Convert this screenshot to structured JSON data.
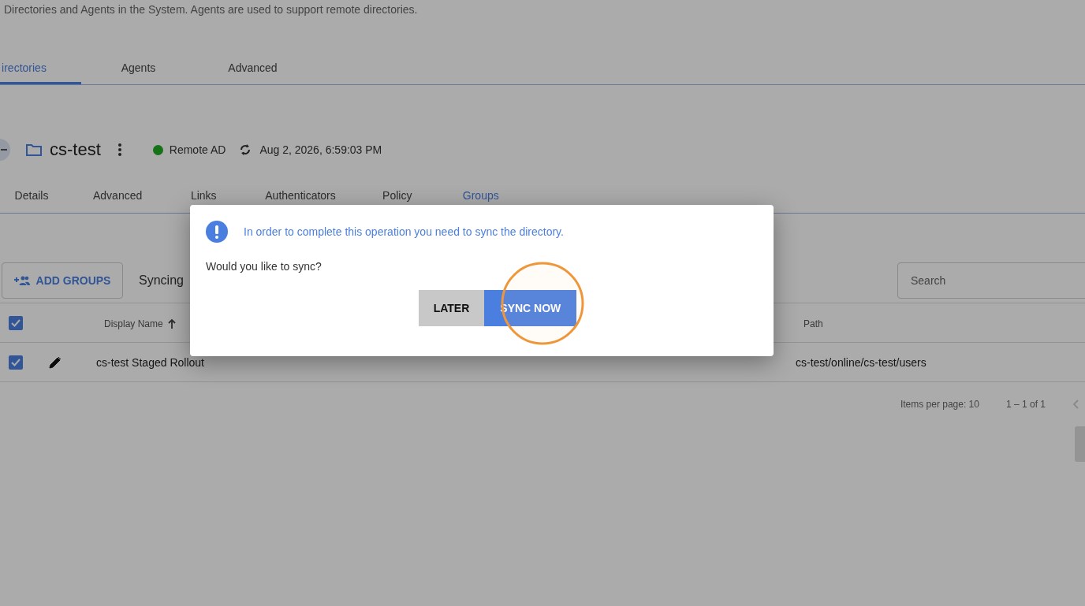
{
  "page": {
    "description": "Directories and Agents in the System. Agents are used to support remote directories."
  },
  "main_tabs": [
    {
      "label": "irectories",
      "selected": true
    },
    {
      "label": "Agents",
      "selected": false
    },
    {
      "label": "Advanced",
      "selected": false
    }
  ],
  "directory": {
    "name": "cs-test",
    "connected": true,
    "type": "Remote AD",
    "last_sync": "Aug 2, 2026, 6:59:03 PM"
  },
  "detail_tabs": [
    {
      "label": "Details",
      "selected": false
    },
    {
      "label": "Advanced",
      "selected": false
    },
    {
      "label": "Links",
      "selected": false
    },
    {
      "label": "Authenticators",
      "selected": false
    },
    {
      "label": "Policy",
      "selected": false
    },
    {
      "label": "Groups",
      "selected": true
    }
  ],
  "toolbar": {
    "add_button": "ADD GROUPS",
    "syncing_label": "Syncing",
    "search": {
      "placeholder": "Search"
    }
  },
  "table": {
    "all_checked": true,
    "columns": [
      {
        "label": "Display Name",
        "sorted": true
      },
      {
        "label": "Path",
        "sorted": false
      }
    ],
    "rows": [
      {
        "checked": true,
        "display_name": "cs-test Staged Rollout",
        "path": "cs-test/online/cs-test/users"
      }
    ]
  },
  "pagination": {
    "items_per_page": "Items per page: 10",
    "range": "1 – 1 of 1"
  },
  "dialog": {
    "message": "In order to complete this operation you need to sync the directory.",
    "question": "Would you like to sync?",
    "buttons": [
      {
        "label": "LATER",
        "kind": "secondary"
      },
      {
        "label": "SYNC NOW",
        "kind": "primary"
      }
    ]
  }
}
